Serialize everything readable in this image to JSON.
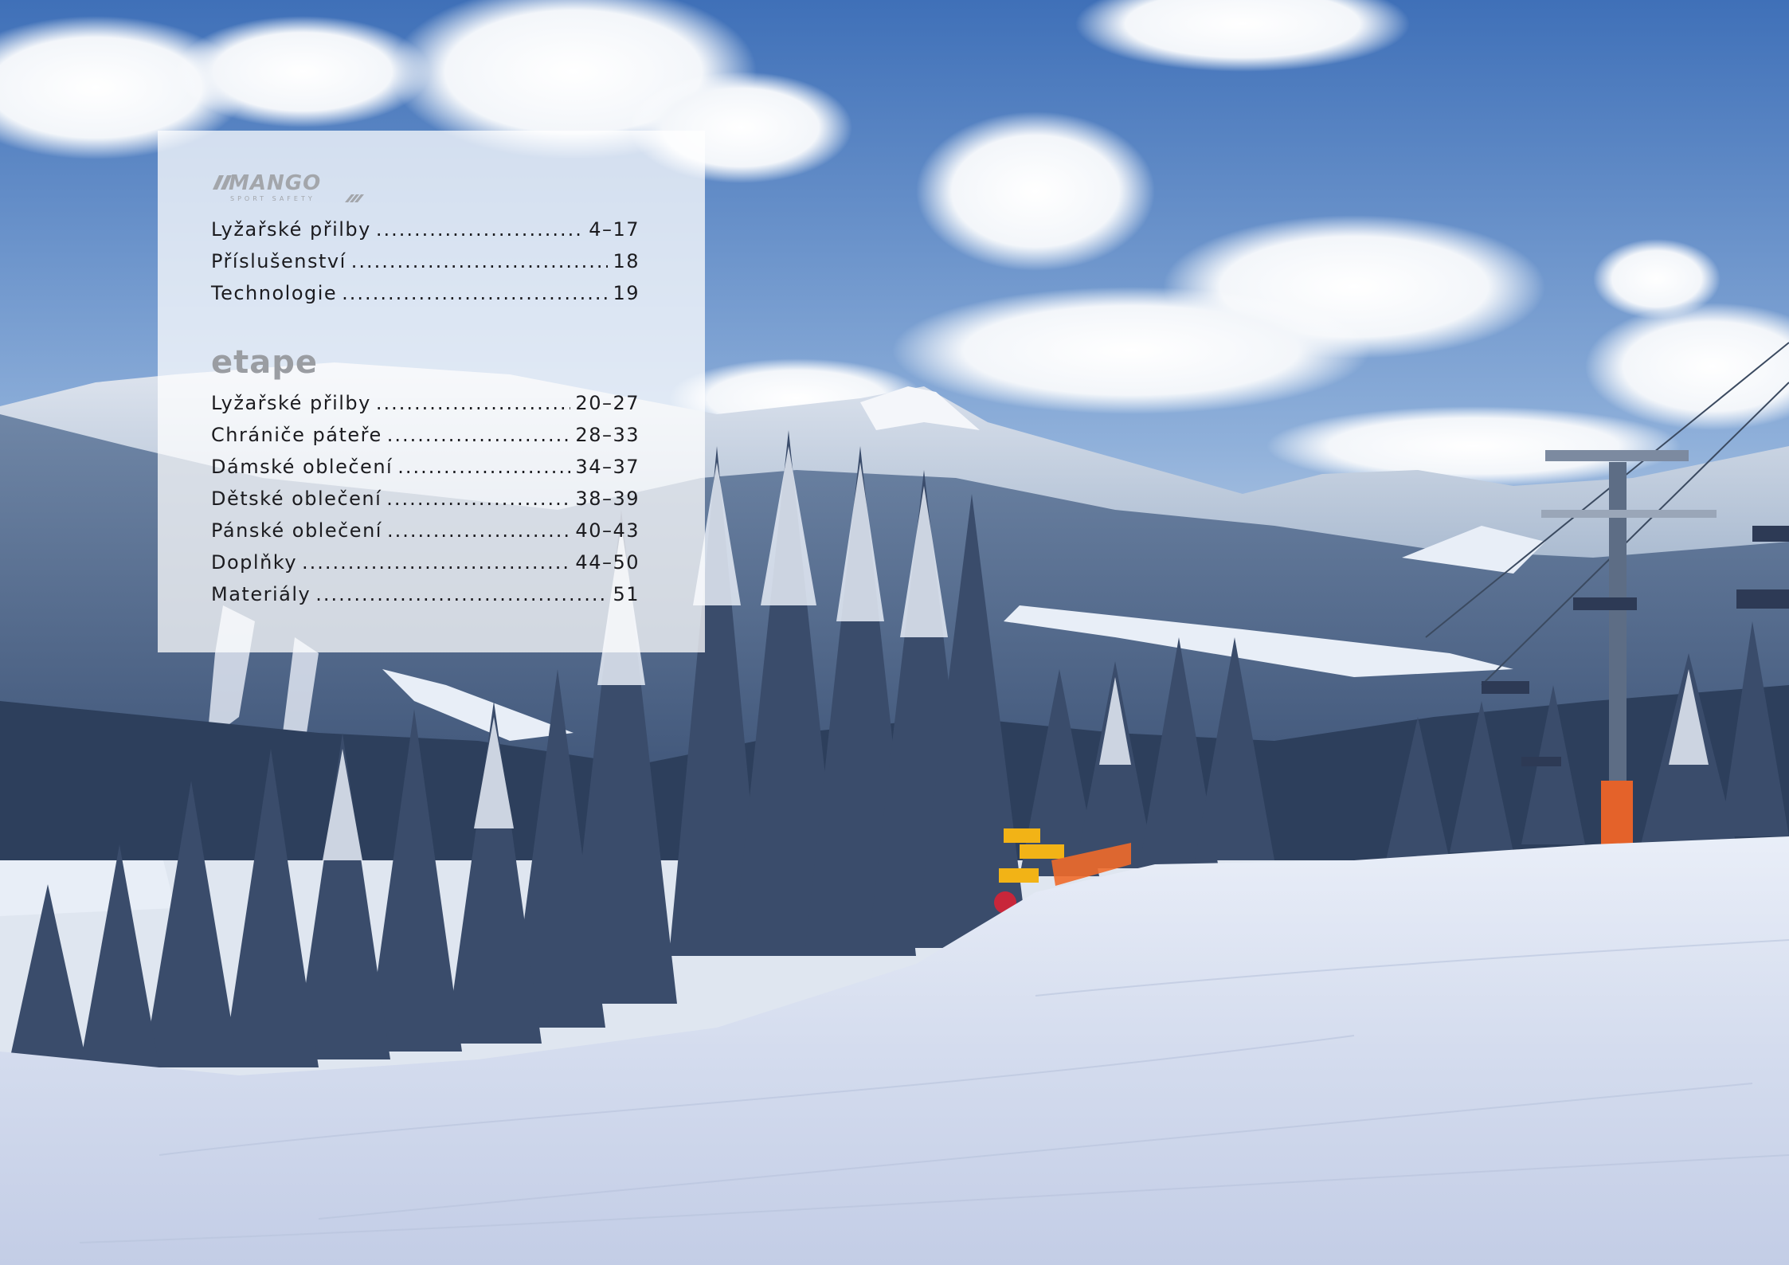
{
  "brands": [
    {
      "logo": {
        "wordmark": "MANGO",
        "tagline": "SPORT SAFETY",
        "color": "#a3a6ab"
      },
      "entries": [
        {
          "label": "Lyžařské přilby",
          "pages": "4–17"
        },
        {
          "label": "Příslušenství",
          "pages": "18"
        },
        {
          "label": "Technologie",
          "pages": "19"
        }
      ]
    },
    {
      "logo": {
        "wordmark": "etape",
        "color": "#9a9da2"
      },
      "entries": [
        {
          "label": "Lyžařské přilby",
          "pages": "20–27"
        },
        {
          "label": "Chrániče páteře",
          "pages": "28–33"
        },
        {
          "label": "Dámské oblečení",
          "pages": "34–37"
        },
        {
          "label": "Dětské oblečení",
          "pages": "38–39"
        },
        {
          "label": "Pánské oblečení",
          "pages": "40–43"
        },
        {
          "label": "Doplňky",
          "pages": "44–50"
        },
        {
          "label": "Materiály",
          "pages": "51"
        }
      ]
    }
  ],
  "colors": {
    "sky": "#4f7ec0",
    "panel": "#ffffff",
    "text": "#1b1b1f",
    "sign": "#f2b316",
    "pylon_base": "#e4622a"
  }
}
